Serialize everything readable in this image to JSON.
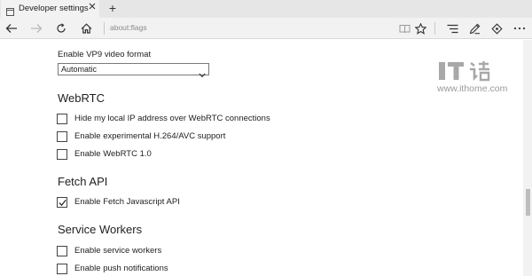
{
  "browser": {
    "tab_title": "Developer settings",
    "new_tab_symbol": "+",
    "address": "about:flags",
    "icons": {
      "back": "back-arrow-icon",
      "forward": "forward-arrow-icon",
      "refresh": "refresh-icon",
      "home": "home-icon",
      "reading_view": "reading-view-icon",
      "favorite": "star-icon",
      "hub": "hub-icon",
      "notes": "web-note-icon",
      "share": "share-icon",
      "more": "more-icon"
    }
  },
  "vp9": {
    "label": "Enable VP9 video format",
    "selected": "Automatic"
  },
  "sections": [
    {
      "title": "WebRTC",
      "options": [
        {
          "label": "Hide my local IP address over WebRTC connections",
          "checked": false
        },
        {
          "label": "Enable experimental H.264/AVC support",
          "checked": false
        },
        {
          "label": "Enable WebRTC 1.0",
          "checked": false
        }
      ]
    },
    {
      "title": "Fetch API",
      "options": [
        {
          "label": "Enable Fetch Javascript API",
          "checked": true
        }
      ]
    },
    {
      "title": "Service Workers",
      "options": [
        {
          "label": "Enable service workers",
          "checked": false
        },
        {
          "label": "Enable push notifications",
          "checked": false
        }
      ]
    }
  ],
  "watermark": {
    "url": "www.ithome.com",
    "logo": "ithome-logo"
  },
  "colors": {
    "tab_bar": "#e6e6e6",
    "nav_bar": "#f2f2f2",
    "text": "#1e1e1e",
    "address_text": "#8a8a8a"
  }
}
